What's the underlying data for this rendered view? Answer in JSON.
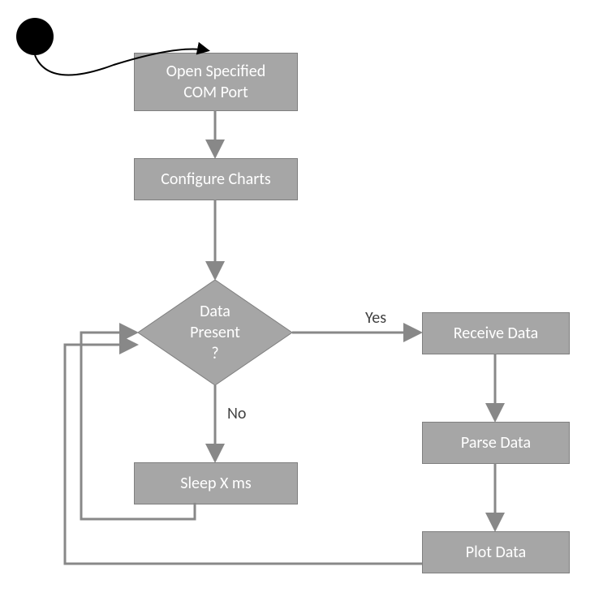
{
  "nodes": {
    "open_com": "Open Specified\nCOM Port",
    "configure_charts": "Configure Charts",
    "data_present": "Data\nPresent\n?",
    "receive_data": "Receive Data",
    "parse_data": "Parse Data",
    "plot_data": "Plot Data",
    "sleep": "Sleep X ms"
  },
  "labels": {
    "yes": "Yes",
    "no": "No"
  }
}
